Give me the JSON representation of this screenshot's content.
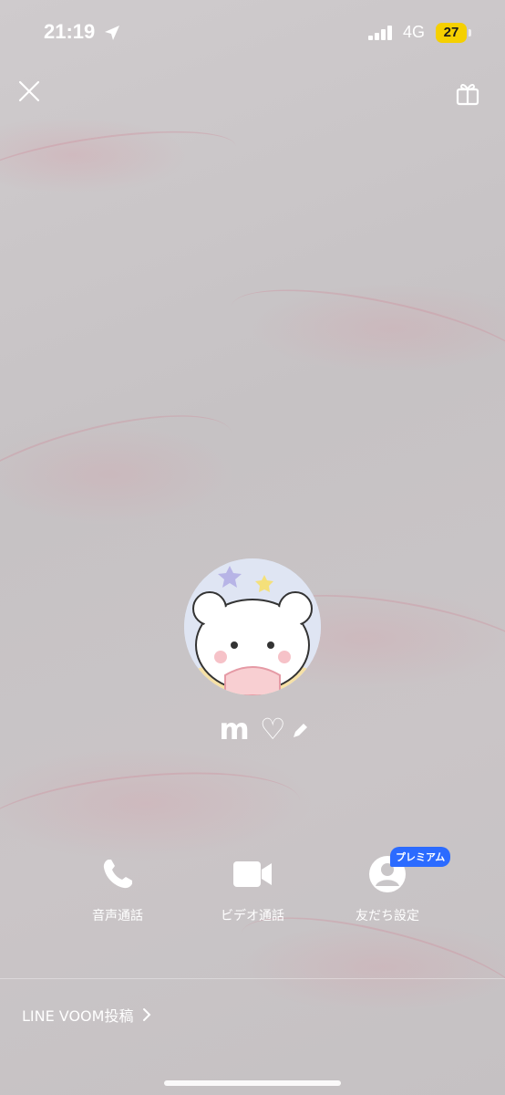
{
  "status_bar": {
    "time": "21:19",
    "network": "4G",
    "battery": "27",
    "battery_color": "#f5d000"
  },
  "header": {
    "close_icon": "close-icon",
    "gift_icon": "gift-icon"
  },
  "profile": {
    "name": "m ♡",
    "avatar_description_icon": "avatar-bear-image",
    "edit_icon": "pencil-icon"
  },
  "actions": {
    "voice_call_label": "音声通話",
    "video_call_label": "ビデオ通話",
    "friend_settings_label": "友だち設定",
    "premium_badge": "プレミアム",
    "premium_color": "#2b6bff"
  },
  "footer": {
    "voom_label": "LINE VOOM投稿"
  }
}
